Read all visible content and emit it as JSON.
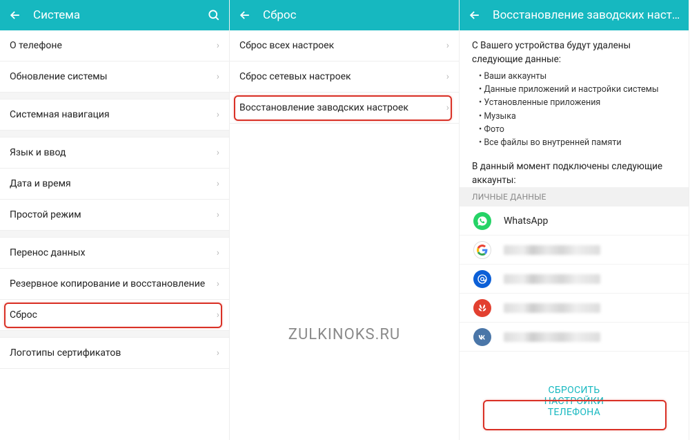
{
  "panel1": {
    "title": "Система",
    "items": [
      {
        "label": "О телефоне"
      },
      {
        "label": "Обновление системы"
      },
      {
        "gap": true
      },
      {
        "label": "Системная навигация"
      },
      {
        "gap": true
      },
      {
        "label": "Язык и ввод"
      },
      {
        "label": "Дата и время"
      },
      {
        "label": "Простой режим"
      },
      {
        "gap": true
      },
      {
        "label": "Перенос данных"
      },
      {
        "label": "Резервное копирование и восстановление"
      },
      {
        "label": "Сброс",
        "highlighted": true
      },
      {
        "gap": true
      },
      {
        "label": "Логотипы сертификатов"
      }
    ]
  },
  "panel2": {
    "title": "Сброс",
    "items": [
      {
        "label": "Сброс всех настроек"
      },
      {
        "label": "Сброс сетевых настроек"
      },
      {
        "label": "Восстановление заводских настроек",
        "highlighted": true
      }
    ],
    "watermark": "ZULKINOKS.RU"
  },
  "panel3": {
    "title": "Восстановление заводских настроек",
    "intro": "С Вашего устройства будут удалены следующие данные:",
    "bullets": [
      "Ваши аккаунты",
      "Данные приложений и настройки системы",
      "Установленные приложения",
      "Музыка",
      "Фото",
      "Все файлы во внутренней памяти"
    ],
    "accounts_intro": "В данный момент подключены следующие аккаунты:",
    "section_label": "ЛИЧНЫЕ ДАННЫЕ",
    "accounts": [
      {
        "name": "WhatsApp",
        "icon": "whatsapp",
        "blurred": false
      },
      {
        "name": "",
        "icon": "google",
        "blurred": true
      },
      {
        "name": "",
        "icon": "mail",
        "blurred": true
      },
      {
        "name": "",
        "icon": "huawei",
        "blurred": true
      },
      {
        "name": "",
        "icon": "vk",
        "blurred": true
      }
    ],
    "reset_button": "СБРОСИТЬ НАСТРОЙКИ ТЕЛЕФОНА"
  }
}
